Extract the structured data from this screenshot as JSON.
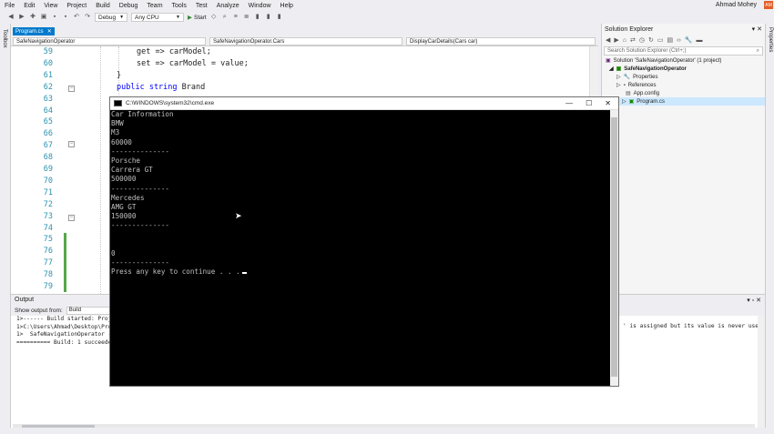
{
  "menu": [
    "File",
    "Edit",
    "View",
    "Project",
    "Build",
    "Debug",
    "Team",
    "Tools",
    "Test",
    "Analyze",
    "Window",
    "Help"
  ],
  "user": {
    "name": "Ahmad Mohey",
    "initials": "AM"
  },
  "toolbar": {
    "config": "Debug",
    "platform": "Any CPU",
    "start": "Start"
  },
  "sidebars": {
    "left": "Toolbox",
    "right": "Properties"
  },
  "document": {
    "tab": "Program.cs"
  },
  "navbar": {
    "project": "SafeNavigationOperator",
    "class": "SafeNavigationOperator.Cars",
    "member": "DisplayCarDetails(Cars car)"
  },
  "editor": {
    "lines": [
      {
        "n": "59",
        "code": "get => carModel;"
      },
      {
        "n": "60",
        "code": "set => carModel = value;"
      },
      {
        "n": "61",
        "code": "}"
      },
      {
        "n": "62",
        "kw": "public string",
        "code": " Brand"
      },
      {
        "n": "63",
        "code": ""
      },
      {
        "n": "64",
        "code": ""
      },
      {
        "n": "65",
        "code": ""
      },
      {
        "n": "66",
        "code": ""
      },
      {
        "n": "67",
        "code": ""
      },
      {
        "n": "68",
        "code": ""
      },
      {
        "n": "69",
        "code": ""
      },
      {
        "n": "70",
        "code": ""
      },
      {
        "n": "71",
        "code": ""
      },
      {
        "n": "72",
        "code": ""
      },
      {
        "n": "73",
        "code": ""
      },
      {
        "n": "74",
        "code": ""
      },
      {
        "n": "75",
        "code": ""
      },
      {
        "n": "76",
        "code": ""
      },
      {
        "n": "77",
        "code": ""
      },
      {
        "n": "78",
        "code": ""
      },
      {
        "n": "79",
        "code": ""
      }
    ]
  },
  "solution_explorer": {
    "title": "Solution Explorer",
    "search_placeholder": "Search Solution Explorer (Ctrl+;)",
    "items": [
      {
        "label": "Solution 'SafeNavigationOperator' (1 project)"
      },
      {
        "label": "SafeNavigationOperator"
      },
      {
        "label": "Properties"
      },
      {
        "label": "References"
      },
      {
        "label": "App.config"
      },
      {
        "label": "Program.cs"
      }
    ]
  },
  "output": {
    "title": "Output",
    "show_from_label": "Show output from:",
    "source": "Build",
    "lines": [
      "1>------ Build started: Proj",
      "1>C:\\Users\\Ahmad\\Desktop\\Pro",
      "1>  SafeNavigationOperator -",
      "========== Build: 1 succeede"
    ],
    "warning": "' is assigned but its value is never used"
  },
  "cmd": {
    "title": "C:\\WINDOWS\\system32\\cmd.exe",
    "lines": [
      "Car Information",
      "BMW",
      "M3",
      "60000",
      "--------------",
      "Porsche",
      "Carrera GT",
      "500000",
      "--------------",
      "Mercedes",
      "AMG GT",
      "150000",
      "--------------",
      "",
      "",
      "0",
      "--------------",
      "Press any key to continue . . ."
    ]
  }
}
